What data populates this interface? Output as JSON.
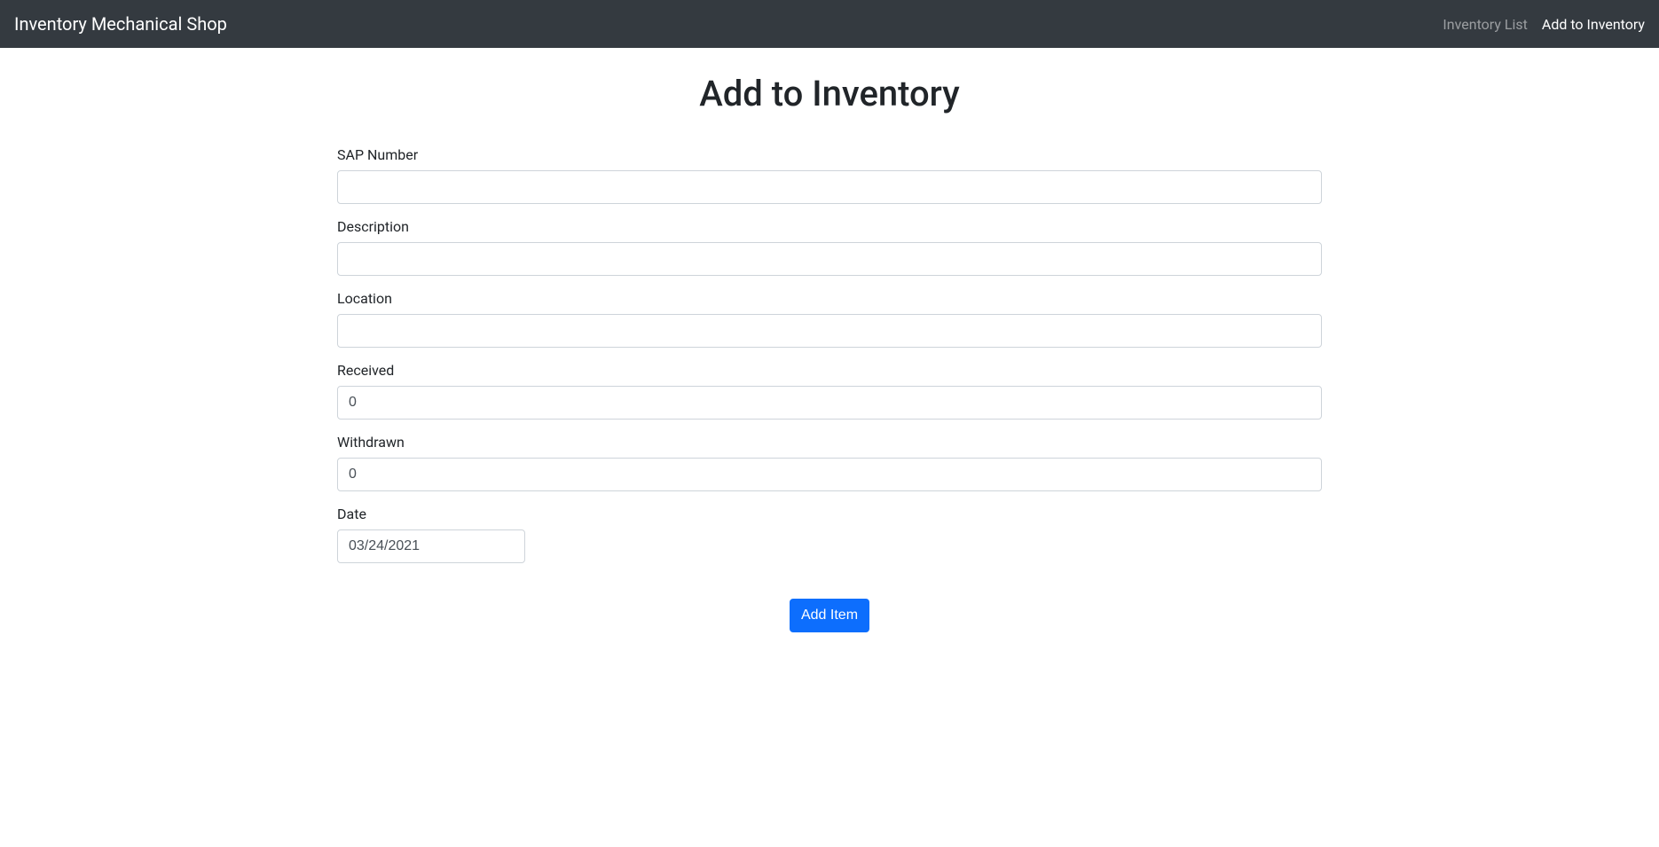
{
  "navbar": {
    "brand": "Inventory Mechanical Shop",
    "links": {
      "inventory_list": "Inventory List",
      "add_to_inventory": "Add to Inventory"
    }
  },
  "page": {
    "title": "Add to Inventory"
  },
  "form": {
    "sap_number": {
      "label": "SAP Number",
      "value": ""
    },
    "description": {
      "label": "Description",
      "value": ""
    },
    "location": {
      "label": "Location",
      "value": ""
    },
    "received": {
      "label": "Received",
      "value": "0"
    },
    "withdrawn": {
      "label": "Withdrawn",
      "value": "0"
    },
    "date": {
      "label": "Date",
      "value": "03/24/2021"
    },
    "submit_label": "Add Item"
  }
}
